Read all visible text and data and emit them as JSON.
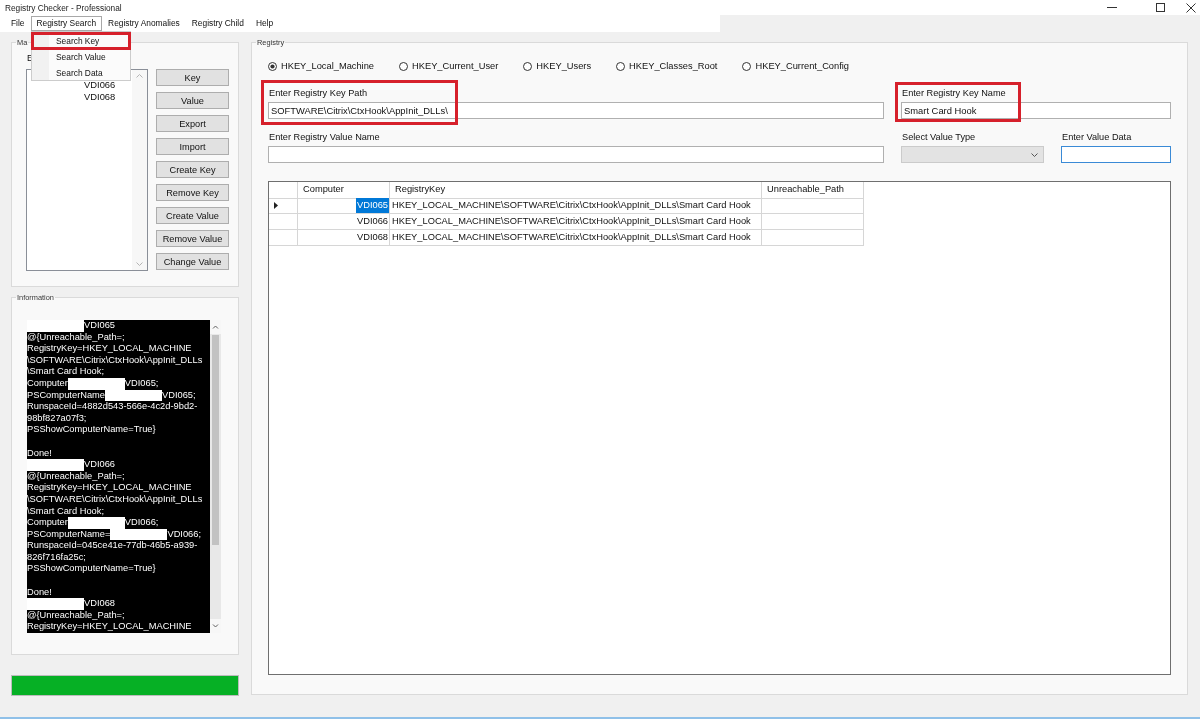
{
  "window": {
    "title": "Registry Checker - Professional",
    "controls": [
      {
        "kind": "minimize"
      },
      {
        "kind": "maximize"
      },
      {
        "kind": "close"
      }
    ]
  },
  "menu_bar": {
    "items": [
      {
        "label": "File",
        "selected": false
      },
      {
        "label": "Registry Search",
        "selected": true
      },
      {
        "label": "Registry Anomalies",
        "selected": false
      },
      {
        "label": "Registry Child",
        "selected": false
      },
      {
        "label": "Help",
        "selected": false
      }
    ]
  },
  "open_menu": {
    "items": [
      {
        "label": "Search Key",
        "annotated": true
      },
      {
        "label": "Search Value",
        "annotated": false
      },
      {
        "label": "Search Data",
        "annotated": false
      }
    ]
  },
  "machines_panel": {
    "caption": "Ma",
    "label": "E",
    "list": [
      {
        "text": "VDI066",
        "redacted": true
      },
      {
        "text": "VDI068",
        "redacted": true
      }
    ],
    "buttons": [
      "Key",
      "Value",
      "Export",
      "Import",
      "Create Key",
      "Remove Key",
      "Create Value",
      "Remove Value",
      "Change Value"
    ]
  },
  "information_panel": {
    "caption": "Information",
    "log": [
      {
        "kind": "redacted",
        "after": "VDI065"
      },
      {
        "kind": "text",
        "text": "@{Unreachable_Path=;"
      },
      {
        "kind": "text",
        "text": "RegistryKey=HKEY_LOCAL_MACHINE"
      },
      {
        "kind": "text",
        "text": "\\SOFTWARE\\Citrix\\CtxHook\\AppInit_DLLs"
      },
      {
        "kind": "text",
        "text": "\\Smart Card Hook;"
      },
      {
        "kind": "redacted",
        "before": "Computer",
        "after": "VDI065;"
      },
      {
        "kind": "redacted",
        "before": "PSComputerName",
        "after": "VDI065;"
      },
      {
        "kind": "text",
        "text": "RunspaceId=4882d543-566e-4c2d-9bd2-"
      },
      {
        "kind": "text",
        "text": "98bf827a07f3;"
      },
      {
        "kind": "text",
        "text": "PSShowComputerName=True}"
      },
      {
        "kind": "blank"
      },
      {
        "kind": "text",
        "text": "Done!"
      },
      {
        "kind": "redacted",
        "after": "VDI066"
      },
      {
        "kind": "text",
        "text": "@{Unreachable_Path=;"
      },
      {
        "kind": "text",
        "text": "RegistryKey=HKEY_LOCAL_MACHINE"
      },
      {
        "kind": "text",
        "text": "\\SOFTWARE\\Citrix\\CtxHook\\AppInit_DLLs"
      },
      {
        "kind": "text",
        "text": "\\Smart Card Hook;"
      },
      {
        "kind": "redacted",
        "before": "Computer",
        "after": "VDI066;"
      },
      {
        "kind": "redacted",
        "before": "PSComputerName=",
        "after": "VDI066;"
      },
      {
        "kind": "text",
        "text": "RunspaceId=045ce41e-77db-46b5-a939-"
      },
      {
        "kind": "text",
        "text": "826f716fa25c;"
      },
      {
        "kind": "text",
        "text": "PSShowComputerName=True}"
      },
      {
        "kind": "blank"
      },
      {
        "kind": "text",
        "text": "Done!"
      },
      {
        "kind": "redacted",
        "after": "VDI068"
      },
      {
        "kind": "text",
        "text": "@{Unreachable_Path=;"
      },
      {
        "kind": "text",
        "text": "RegistryKey=HKEY_LOCAL_MACHINE"
      }
    ]
  },
  "progress": {
    "level": 1
  },
  "registry_panel": {
    "caption": "Registry",
    "hives": [
      {
        "label": "HKEY_Local_Machine",
        "selected": true
      },
      {
        "label": "HKEY_Current_User",
        "selected": false
      },
      {
        "label": "HKEY_Users",
        "selected": false
      },
      {
        "label": "HKEY_Classes_Root",
        "selected": false
      },
      {
        "label": "HKEY_Current_Config",
        "selected": false
      }
    ],
    "fields": [
      {
        "kind": "text",
        "label": "Enter Registry Key Path",
        "value": "SOFTWARE\\Citrix\\CtxHook\\AppInit_DLLs\\",
        "annotated": true,
        "focused": false,
        "disabled": false
      },
      {
        "kind": "text",
        "label": "Enter Registry Key Name",
        "value": "Smart Card Hook",
        "annotated": true,
        "focused": false,
        "disabled": false
      },
      {
        "kind": "text",
        "label": "Enter Registry Value Name",
        "annotated": false,
        "focused": false,
        "disabled": false
      },
      {
        "kind": "combo",
        "label": "Select Value Type",
        "annotated": false,
        "focused": false,
        "disabled": true
      },
      {
        "kind": "text",
        "label": "Enter Value Data",
        "annotated": false,
        "focused": true,
        "disabled": false
      }
    ],
    "results_table": {
      "columns": [
        "Computer",
        "RegistryKey",
        "Unreachable_Path"
      ],
      "rows": [
        {
          "current": true,
          "selected": true,
          "computer": "VDI065",
          "registry_key": "HKEY_LOCAL_MACHINE\\SOFTWARE\\Citrix\\CtxHook\\AppInit_DLLs\\Smart Card Hook"
        },
        {
          "current": false,
          "selected": false,
          "computer": "VDI066",
          "registry_key": "HKEY_LOCAL_MACHINE\\SOFTWARE\\Citrix\\CtxHook\\AppInit_DLLs\\Smart Card Hook"
        },
        {
          "current": false,
          "selected": false,
          "computer": "VDI068",
          "registry_key": "HKEY_LOCAL_MACHINE\\SOFTWARE\\Citrix\\CtxHook\\AppInit_DLLs\\Smart Card Hook"
        }
      ]
    }
  }
}
